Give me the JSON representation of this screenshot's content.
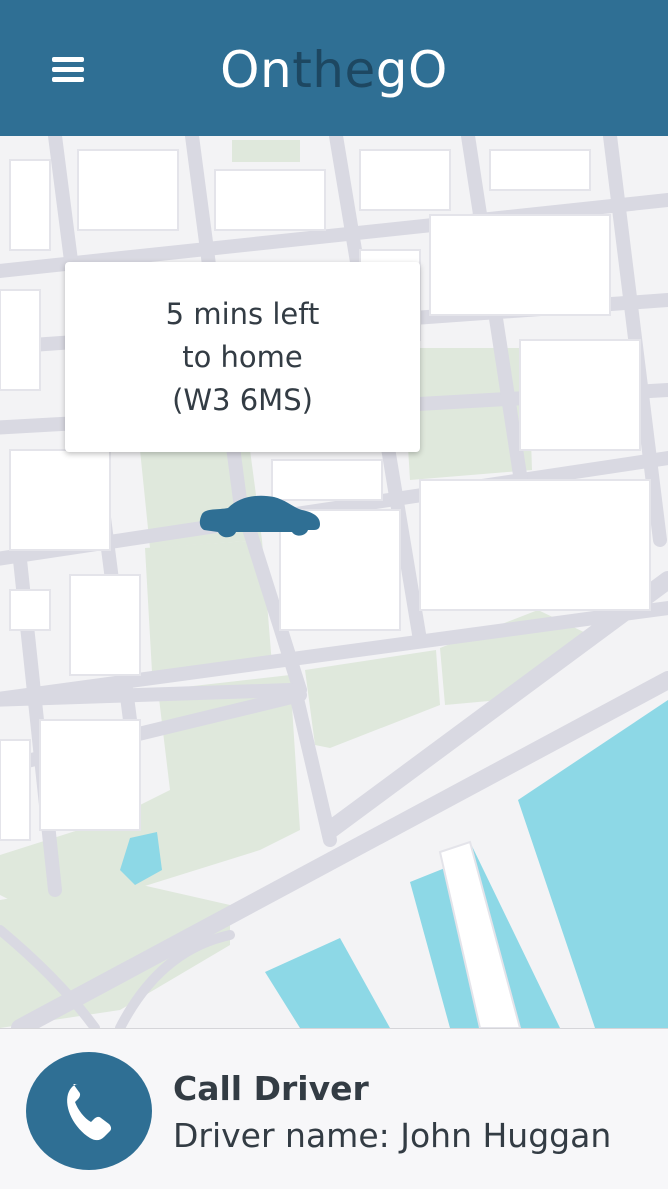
{
  "app": {
    "logo_segments": [
      {
        "text": "On",
        "tone": "light"
      },
      {
        "text": "the",
        "tone": "dark"
      },
      {
        "text": "gO",
        "tone": "light"
      }
    ]
  },
  "header": {
    "menu_icon": "hamburger-menu-icon"
  },
  "map": {
    "eta_popup": {
      "lines": [
        "5 mins left",
        "to home",
        "(W3 6MS)"
      ]
    },
    "vehicle_icon": "car-icon"
  },
  "footer": {
    "call_icon": "phone-icon",
    "call_label": "Call Driver",
    "driver_label": "Driver name: John Huggan"
  },
  "colors": {
    "brand": "#2f6f94",
    "brand_dark": "#1d4761",
    "park": "#dfe8dc",
    "water": "#8dd8e6",
    "road": "#d9d9e2"
  }
}
